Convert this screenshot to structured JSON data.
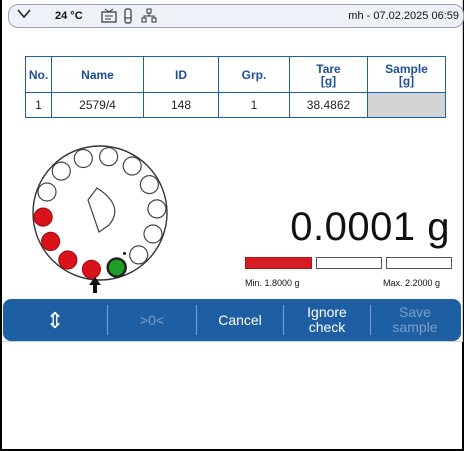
{
  "status": {
    "temperature": "24 °C",
    "user_datetime": "mh - 07.02.2025 06:59",
    "icons": [
      "chevron-down-icon",
      "thermometer-icon",
      "calibration-icon",
      "network-icon"
    ]
  },
  "table": {
    "headers": [
      "No.",
      "Name",
      "ID",
      "Grp.",
      "Tare\n[g]",
      "Sample\n[g]"
    ],
    "rows": [
      {
        "no": "1",
        "name": "2579/4",
        "id": "148",
        "grp": "1",
        "tare": "38.4862",
        "sample": ""
      }
    ]
  },
  "carousel": {
    "positions": [
      {
        "state": "empty"
      },
      {
        "state": "empty"
      },
      {
        "state": "empty"
      },
      {
        "state": "empty"
      },
      {
        "state": "empty"
      },
      {
        "state": "empty"
      },
      {
        "state": "empty"
      },
      {
        "state": "current"
      },
      {
        "state": "done"
      },
      {
        "state": "done"
      },
      {
        "state": "done"
      },
      {
        "state": "done"
      },
      {
        "state": "empty"
      },
      {
        "state": "empty"
      }
    ],
    "colors": {
      "done": "#d9121b",
      "current": "#1f9e2a",
      "empty": "#ffffff"
    }
  },
  "weighing": {
    "value": "0.0001",
    "unit": "g",
    "min_label": "Min. 1.8000 g",
    "max_label": "Max. 2.2000 g",
    "fill_color": "#d51c24"
  },
  "buttons": {
    "nav": "⇕",
    "tare": ">0<",
    "cancel": "Cancel",
    "ignore": "Ignore\ncheck",
    "save": "Save\nsample"
  }
}
